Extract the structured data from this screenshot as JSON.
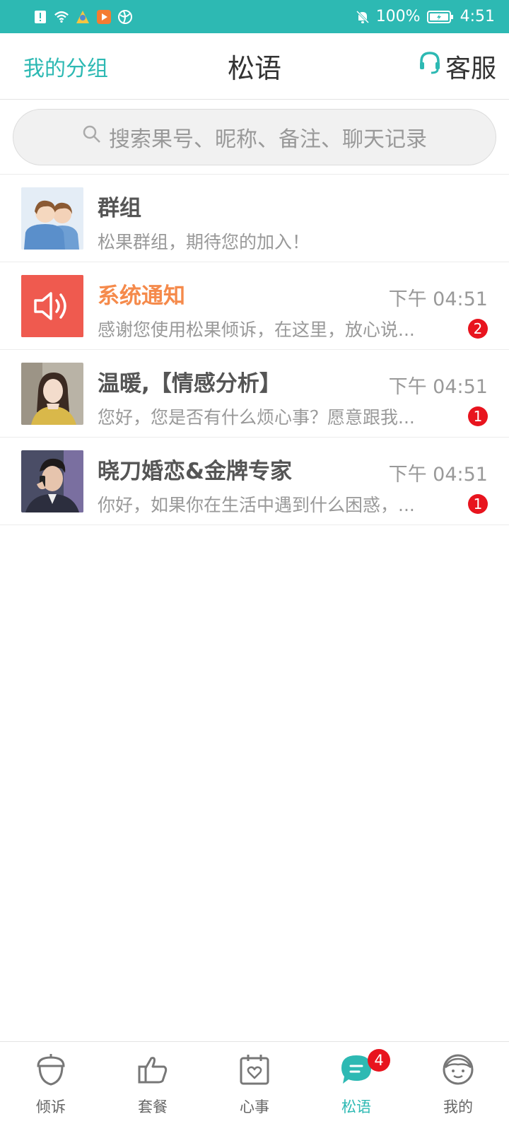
{
  "status_bar": {
    "battery": "100%",
    "time": "4:51"
  },
  "header": {
    "left_link": "我的分组",
    "title": "松语",
    "right_label": "客服"
  },
  "search": {
    "placeholder": "搜索果号、昵称、备注、聊天记录"
  },
  "conversations": [
    {
      "name": "群组",
      "preview": "松果群组，期待您的加入！",
      "time": "",
      "badge": ""
    },
    {
      "name": "系统通知",
      "preview": "感谢您使用松果倾诉，在这里，放心说...",
      "time": "下午 04:51",
      "badge": "2"
    },
    {
      "name": "温暖,【情感分析】",
      "preview": "您好，您是否有什么烦心事？愿意跟我...",
      "time": "下午 04:51",
      "badge": "1"
    },
    {
      "name": "晓刀婚恋&金牌专家",
      "preview": "你好，如果你在生活中遇到什么困惑，...",
      "time": "下午 04:51",
      "badge": "1"
    }
  ],
  "bottom_nav": {
    "items": [
      {
        "label": "倾诉",
        "icon": "acorn-icon"
      },
      {
        "label": "套餐",
        "icon": "thumbs-up-icon"
      },
      {
        "label": "心事",
        "icon": "calendar-heart-icon"
      },
      {
        "label": "松语",
        "icon": "chat-bubble-icon",
        "badge": "4"
      },
      {
        "label": "我的",
        "icon": "face-icon"
      }
    ]
  },
  "colors": {
    "accent": "#2db9b3",
    "badge": "#e8141e",
    "notice_name": "#f58a4b",
    "notice_avatar": "#ef5a4f"
  }
}
